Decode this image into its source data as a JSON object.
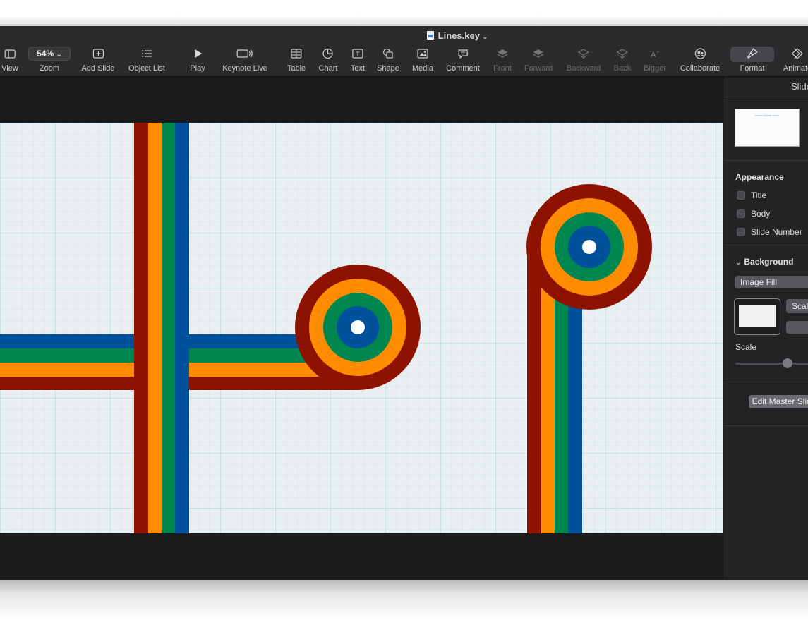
{
  "window": {
    "document_title": "Lines.key"
  },
  "toolbar": {
    "view": "View",
    "zoom_value": "54%",
    "zoom": "Zoom",
    "add_slide": "Add Slide",
    "object_list": "Object List",
    "play": "Play",
    "keynote_live": "Keynote Live",
    "table": "Table",
    "chart": "Chart",
    "text": "Text",
    "shape": "Shape",
    "media": "Media",
    "comment": "Comment",
    "front": "Front",
    "forward": "Forward",
    "backward": "Backward",
    "back": "Back",
    "bigger": "Bigger",
    "collaborate": "Collaborate",
    "format": "Format",
    "animate": "Animate"
  },
  "sidebar": {
    "tab_label": "Slide",
    "thumbnail_text": "Lorem Ipsum Dolor",
    "appearance_heading": "Appearance",
    "checkboxes": [
      {
        "label": "Title",
        "checked": false
      },
      {
        "label": "Body",
        "checked": false
      },
      {
        "label": "Slide Number",
        "checked": false
      }
    ],
    "background_heading": "Background",
    "fill_type": "Image Fill",
    "scale_button": "Scale",
    "scale_label": "Scale",
    "edit_button": "Edit Master Slide"
  },
  "colors": {
    "stripe_red": "#8e1200",
    "stripe_orange": "#ff8c00",
    "stripe_green": "#00874f",
    "stripe_blue": "#00519b",
    "toolbar_bg": "#2b2a2d",
    "sidebar_bg": "#232325"
  }
}
